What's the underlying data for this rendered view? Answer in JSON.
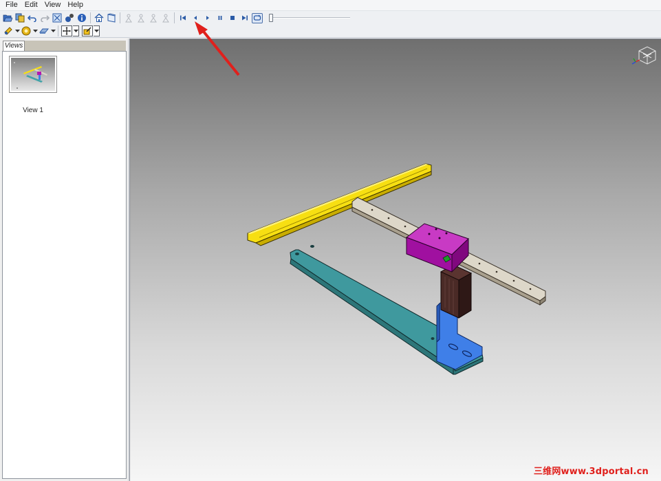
{
  "menubar": {
    "items": [
      "File",
      "Edit",
      "View",
      "Help"
    ]
  },
  "views_panel": {
    "tab_label": "Views",
    "thumbnails": [
      {
        "label": "View 1"
      }
    ]
  },
  "watermark": "三维网www.3dportal.cn",
  "colors": {
    "annotation_arrow": "#e0201c",
    "rail_yellow": "#f7df12",
    "plate_teal": "#40a3a8",
    "carriage_magenta": "#b418b0",
    "bracket_blue": "#3f7fe8",
    "arm_dark": "#3a1f1f",
    "guide_rail": "#ddd7c9"
  },
  "icons": {
    "toolbar1": [
      "open-icon",
      "copy-icon",
      "undo-icon",
      "redo-icon",
      "fit-icon",
      "settings-icon",
      "info-icon",
      "home-icon",
      "view-icon",
      "explode-icon",
      "explode-icon",
      "explode-icon",
      "explode-icon"
    ],
    "playback": [
      "first-icon",
      "prev-icon",
      "play-icon",
      "pause-icon",
      "stop-icon",
      "last-icon",
      "loop-icon"
    ],
    "toolbar2": [
      "light-icon",
      "material-icon",
      "render-icon",
      "pan-icon",
      "select-icon"
    ]
  }
}
